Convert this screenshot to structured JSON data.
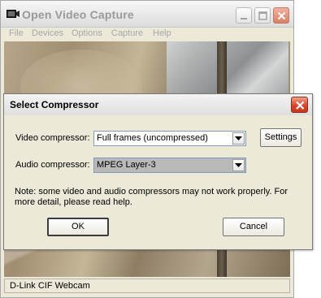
{
  "main_window": {
    "title": "Open Video Capture",
    "menu": [
      "File",
      "Devices",
      "Options",
      "Capture",
      "Help"
    ],
    "status_text": "D-Link CIF Webcam"
  },
  "dialog": {
    "title": "Select Compressor",
    "video_compressor": {
      "label": "Video compressor:",
      "value": "Full frames (uncompressed)"
    },
    "audio_compressor": {
      "label": "Audio compressor:",
      "value": "MPEG Layer-3"
    },
    "settings_label": "Settings",
    "note": "Note: some video and audio compressors may not work properly. For more detail, please read help.",
    "ok_label": "OK",
    "cancel_label": "Cancel"
  },
  "colors": {
    "window_face": "#ece9d8",
    "close_red": "#d9442a",
    "inactive_title_text": "#9a9a9a"
  },
  "icons": {
    "app": "webcam-icon",
    "close": "close-icon",
    "minimize": "minimize-icon",
    "maximize": "maximize-icon",
    "dropdown": "chevron-down-icon"
  }
}
